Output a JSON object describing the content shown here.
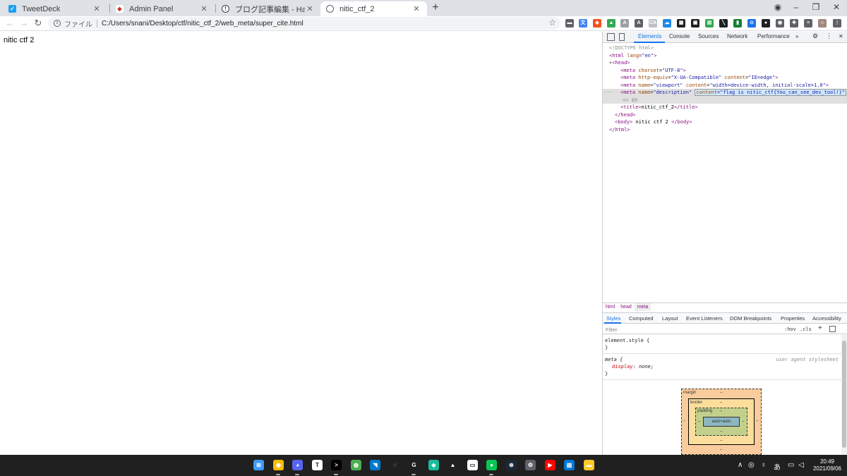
{
  "browser": {
    "tabs": [
      {
        "title": "TweetDeck",
        "icon": "twitter-icon",
        "color": "#1da1f2"
      },
      {
        "title": "Admin Panel",
        "icon": "admin-panel-icon",
        "color": "#c0392b"
      },
      {
        "title": "ブログ記事編集 - Hatena Blog",
        "icon": "hatena-icon",
        "color": "#3c4043"
      },
      {
        "title": "nitic_ctf_2",
        "icon": "globe-icon",
        "color": "#5f6368"
      }
    ],
    "new_tab": "+",
    "window_controls": {
      "minimize": "–",
      "maximize": "❐",
      "close": "✕"
    }
  },
  "toolbar": {
    "back": "←",
    "forward": "→",
    "reload": "↻",
    "scheme_label": "ファイル",
    "url": "C:/Users/snani/Desktop/ctf/nitic_ctf_2/web_meta/super_cite.html",
    "star": "☆"
  },
  "extensions": [
    {
      "name": "ext-speech-icon",
      "color": "#5f6368",
      "glyph": "▬"
    },
    {
      "name": "ext-translate-icon",
      "color": "#4285f4",
      "glyph": "文"
    },
    {
      "name": "ext-tag-icon",
      "color": "#f4511e",
      "glyph": "◆"
    },
    {
      "name": "ext-drive-icon",
      "color": "#34a853",
      "glyph": "▲"
    },
    {
      "name": "ext-a-icon",
      "color": "#9aa0a6",
      "glyph": "A"
    },
    {
      "name": "ext-a2-icon",
      "color": "#5f6368",
      "glyph": "A"
    },
    {
      "name": "ext-ca-icon",
      "color": "#bdc1c6",
      "glyph": "CA"
    },
    {
      "name": "ext-cloud-icon",
      "color": "#1e88e5",
      "glyph": "☁"
    },
    {
      "name": "ext-qr-icon",
      "color": "#202124",
      "glyph": "▦"
    },
    {
      "name": "ext-bag-icon",
      "color": "#202124",
      "glyph": "▣"
    },
    {
      "name": "ext-green-icon",
      "color": "#34a853",
      "glyph": "▤"
    },
    {
      "name": "ext-slash-icon",
      "color": "#202124",
      "glyph": "╲"
    },
    {
      "name": "ext-book-icon",
      "color": "#188038",
      "glyph": "▮"
    },
    {
      "name": "ext-blue-circle-icon",
      "color": "#1a73e8",
      "glyph": "⊙"
    },
    {
      "name": "ext-circle-icon",
      "color": "#202124",
      "glyph": "●"
    },
    {
      "name": "ext-disk-icon",
      "color": "#5f6368",
      "glyph": "◉"
    },
    {
      "name": "ext-puzzle-icon",
      "color": "#5f6368",
      "glyph": "✚"
    },
    {
      "name": "ext-list-icon",
      "color": "#5f6368",
      "glyph": "≡"
    },
    {
      "name": "profile-avatar-icon",
      "color": "#a1887f",
      "glyph": "☺"
    },
    {
      "name": "menu-kebab-icon",
      "color": "#5f6368",
      "glyph": "⋮"
    }
  ],
  "page": {
    "body_text": "nitic ctf 2"
  },
  "devtools": {
    "tabs": [
      "Elements",
      "Console",
      "Sources",
      "Network",
      "Performance"
    ],
    "more": "»",
    "settings": "⚙",
    "kebab": "⋮",
    "close": "✕",
    "dom": {
      "doctype": "<!DOCTYPE html>",
      "html_open_tag": "html",
      "lang_attr": "lang",
      "lang_val": "\"en\"",
      "head_tag": "head",
      "meta1_attr": "charset",
      "meta1_val": "\"UTF-8\"",
      "meta2_attr1": "http-equiv",
      "meta2_val1": "\"X-UA-Compatible\"",
      "meta2_attr2": "content",
      "meta2_val2": "\"IE=edge\"",
      "meta3_attr1": "name",
      "meta3_val1": "\"viewport\"",
      "meta3_attr2": "content",
      "meta3_val2": "\"width=device-width, initial-scale=1.0\"",
      "meta4_attr1": "name",
      "meta4_val1": "\"description\"",
      "meta4_attr2": "content",
      "meta4_val2": "flag is nitic_ctf{You_can_see_dev_tool!}",
      "dollar": "== $0",
      "title_text": "nitic_ctf_2",
      "body_text": " nitic ctf 2 ",
      "dots": "···"
    },
    "breadcrumbs": [
      "html",
      "head",
      "meta"
    ],
    "sub_tabs": [
      "Styles",
      "Computed",
      "Layout",
      "Event Listeners",
      "DOM Breakpoints",
      "Properties",
      "Accessibility"
    ],
    "filter_placeholder": "Filter",
    "hov": ":hov",
    "cls": ".cls",
    "add_rule": "+",
    "styles": {
      "element_style": "element.style {",
      "close_brace": "}",
      "meta_selector": "meta {",
      "ua_label": "user agent stylesheet",
      "prop": "display",
      "val": "none;"
    },
    "box_model": {
      "margin_label": "margin",
      "border_label": "border",
      "padding_label": "padding",
      "content": "auto×auto",
      "dash": "–"
    }
  },
  "taskbar": {
    "apps": [
      {
        "name": "windows-start-icon",
        "color": "#3b9cff",
        "glyph": "⊞"
      },
      {
        "name": "chrome-icon",
        "color": "#fbbc04",
        "glyph": "◉"
      },
      {
        "name": "discord-icon",
        "color": "#5865f2",
        "glyph": "◕"
      },
      {
        "name": "typora-icon",
        "color": "#ffffff",
        "glyph": "T"
      },
      {
        "name": "terminal-icon",
        "color": "#000000",
        "glyph": ">"
      },
      {
        "name": "maps-icon",
        "color": "#4caf50",
        "glyph": "◍"
      },
      {
        "name": "vscode-icon",
        "color": "#007acc",
        "glyph": "◥"
      },
      {
        "name": "github-icon",
        "color": "#202020",
        "glyph": "◌"
      },
      {
        "name": "c-app-icon",
        "color": "#202020",
        "glyph": "G"
      },
      {
        "name": "mint-icon",
        "color": "#1abc9c",
        "glyph": "◈"
      },
      {
        "name": "arrow-app-icon",
        "color": "#202020",
        "glyph": "▲"
      },
      {
        "name": "keyboard-icon",
        "color": "#ffffff",
        "glyph": "▭"
      },
      {
        "name": "line-icon",
        "color": "#06c755",
        "glyph": "●"
      },
      {
        "name": "steam-icon",
        "color": "#1b2838",
        "glyph": "⊗"
      },
      {
        "name": "settings-icon",
        "color": "#5f6368",
        "glyph": "⚙"
      },
      {
        "name": "youtube-music-icon",
        "color": "#ff0000",
        "glyph": "▶"
      },
      {
        "name": "image-app-icon",
        "color": "#0078d4",
        "glyph": "▧"
      },
      {
        "name": "file-explorer-icon",
        "color": "#ffca28",
        "glyph": "▬"
      }
    ],
    "tray": {
      "chevron": "∧",
      "gamepad": "◎",
      "mic": "♁",
      "ime": "あ",
      "display": "▭",
      "volume": "◁"
    },
    "time": "20:49",
    "date": "2021/09/06"
  }
}
